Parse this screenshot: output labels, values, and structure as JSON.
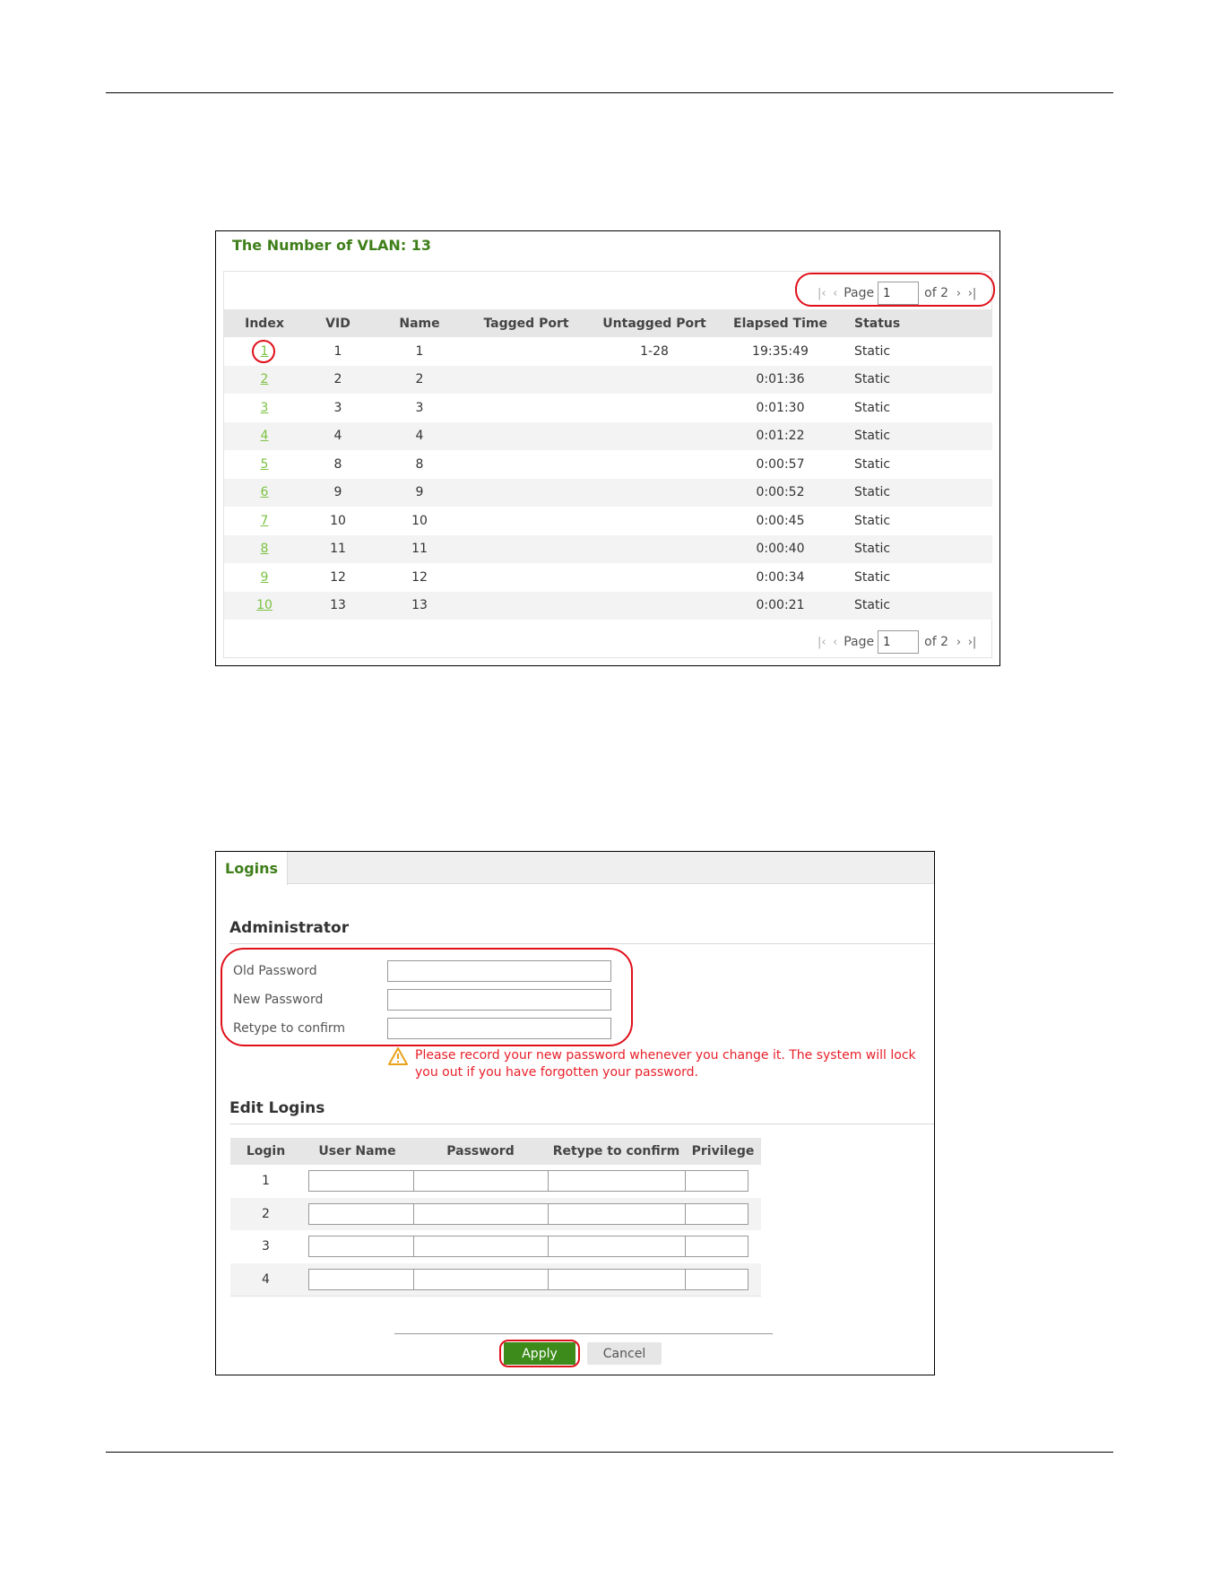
{
  "vlan_panel": {
    "title": "The Number of VLAN: 13",
    "pager": {
      "page_label": "Page",
      "current_page": "1",
      "of_label": "of 2"
    },
    "columns": [
      "Index",
      "VID",
      "Name",
      "Tagged Port",
      "Untagged Port",
      "Elapsed Time",
      "Status"
    ],
    "rows": [
      {
        "index": "1",
        "vid": "1",
        "name": "1",
        "tagged": "",
        "untagged": "1-28",
        "elapsed": "19:35:49",
        "status": "Static"
      },
      {
        "index": "2",
        "vid": "2",
        "name": "2",
        "tagged": "",
        "untagged": "",
        "elapsed": "0:01:36",
        "status": "Static"
      },
      {
        "index": "3",
        "vid": "3",
        "name": "3",
        "tagged": "",
        "untagged": "",
        "elapsed": "0:01:30",
        "status": "Static"
      },
      {
        "index": "4",
        "vid": "4",
        "name": "4",
        "tagged": "",
        "untagged": "",
        "elapsed": "0:01:22",
        "status": "Static"
      },
      {
        "index": "5",
        "vid": "8",
        "name": "8",
        "tagged": "",
        "untagged": "",
        "elapsed": "0:00:57",
        "status": "Static"
      },
      {
        "index": "6",
        "vid": "9",
        "name": "9",
        "tagged": "",
        "untagged": "",
        "elapsed": "0:00:52",
        "status": "Static"
      },
      {
        "index": "7",
        "vid": "10",
        "name": "10",
        "tagged": "",
        "untagged": "",
        "elapsed": "0:00:45",
        "status": "Static"
      },
      {
        "index": "8",
        "vid": "11",
        "name": "11",
        "tagged": "",
        "untagged": "",
        "elapsed": "0:00:40",
        "status": "Static"
      },
      {
        "index": "9",
        "vid": "12",
        "name": "12",
        "tagged": "",
        "untagged": "",
        "elapsed": "0:00:34",
        "status": "Static"
      },
      {
        "index": "10",
        "vid": "13",
        "name": "13",
        "tagged": "",
        "untagged": "",
        "elapsed": "0:00:21",
        "status": "Static"
      }
    ]
  },
  "logins_panel": {
    "tab_label": "Logins",
    "administrator": {
      "title": "Administrator",
      "old_password_label": "Old Password",
      "new_password_label": "New Password",
      "retype_label": "Retype to confirm",
      "warning": "Please record your new password whenever you change it. The system will lock you out if you have forgotten your password."
    },
    "edit_logins": {
      "title": "Edit Logins",
      "columns": [
        "Login",
        "User Name",
        "Password",
        "Retype to confirm",
        "Privilege"
      ],
      "rows": [
        "1",
        "2",
        "3",
        "4"
      ]
    },
    "apply_label": "Apply",
    "cancel_label": "Cancel"
  },
  "colors": {
    "accent_green": "#3f7f1a",
    "link_green": "#7cc243",
    "apply_green": "#3d8b1b",
    "highlight_red": "#e0101b",
    "warning_red": "#e8202a",
    "warning_icon_orange": "#e8a21a"
  }
}
